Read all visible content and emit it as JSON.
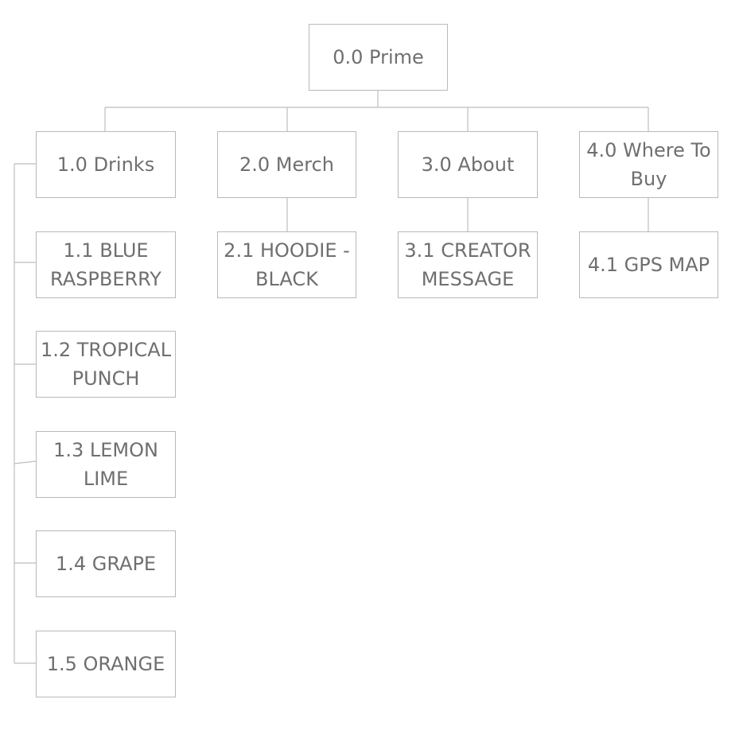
{
  "diagram": {
    "root": {
      "label": "0.0 Prime"
    },
    "categories": [
      {
        "label": "1.0 Drinks",
        "children": [
          "1.1 BLUE RASPBERRY",
          "1.2 TROPICAL PUNCH",
          "1.3 LEMON LIME",
          "1.4 GRAPE",
          "1.5 ORANGE"
        ]
      },
      {
        "label": "2.0 Merch",
        "children": [
          "2.1 HOODIE - BLACK"
        ]
      },
      {
        "label": "3.0 About",
        "children": [
          "3.1 CREATOR MESSAGE"
        ]
      },
      {
        "label": "4.0 Where To Buy",
        "children": [
          "4.1 GPS MAP"
        ]
      }
    ],
    "colors": {
      "line": "#bdbdbd",
      "border": "#b9b9b9",
      "text": "#6f6f6f",
      "background": "#ffffff"
    }
  }
}
